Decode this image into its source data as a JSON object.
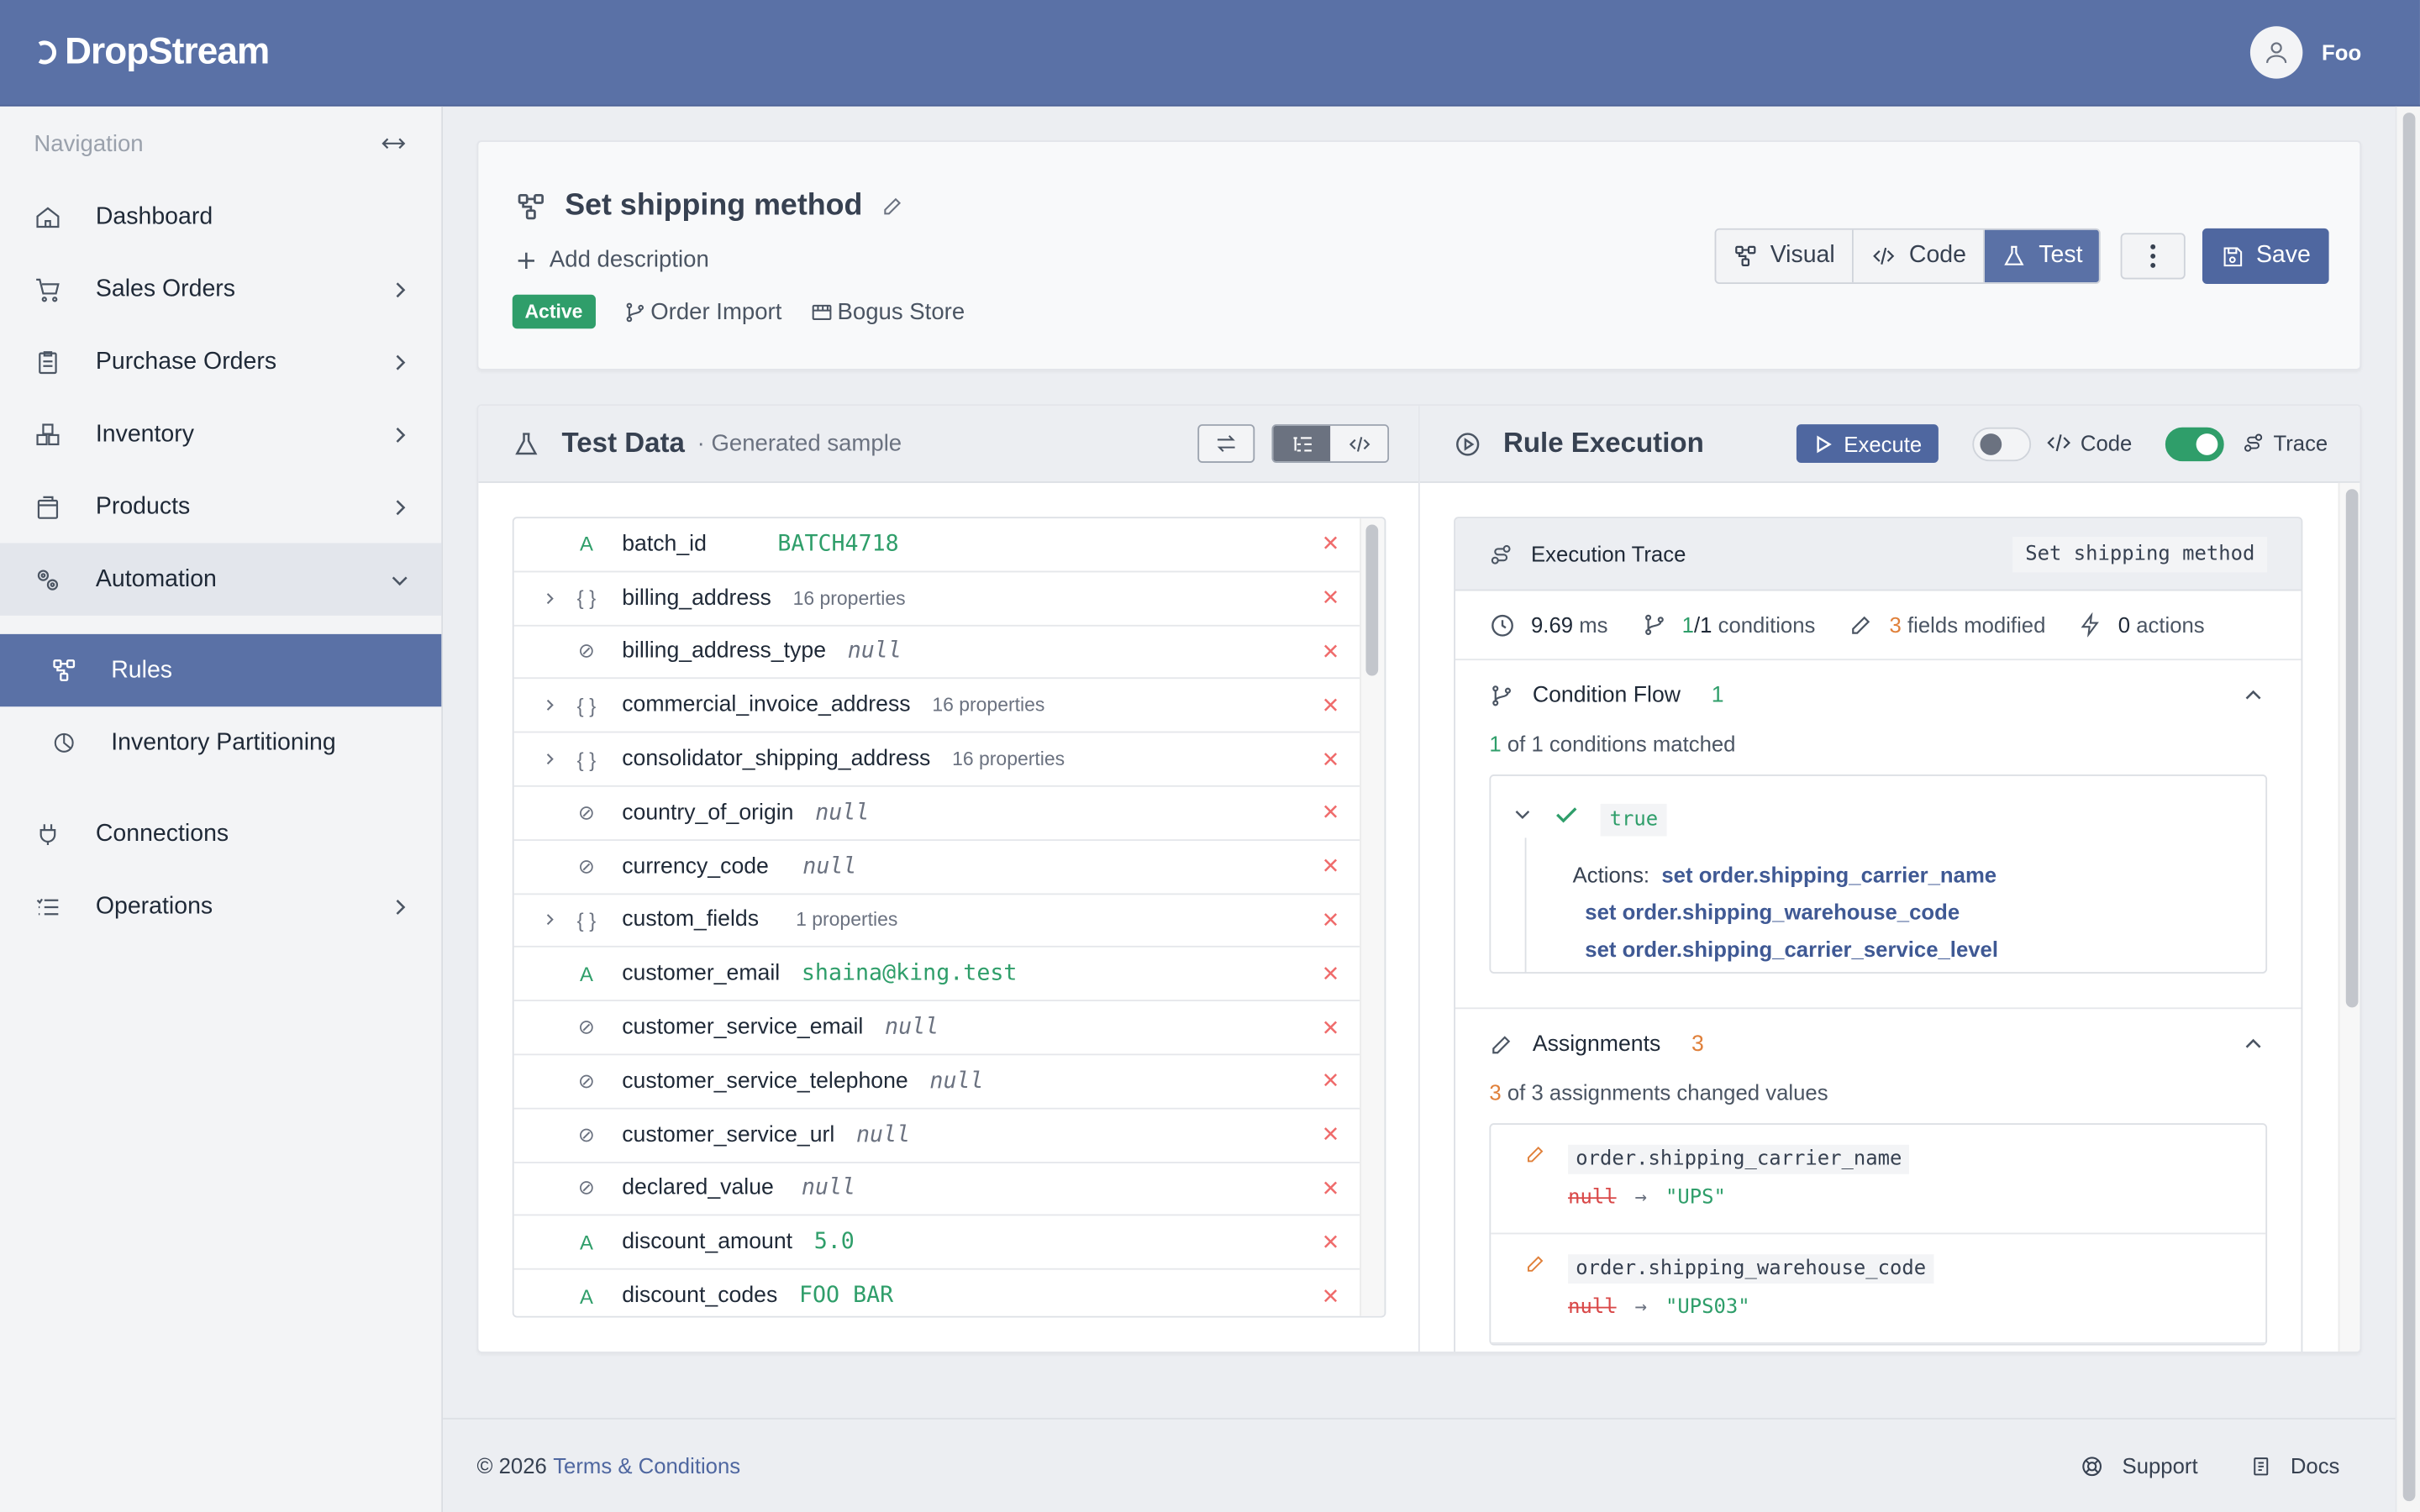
{
  "brand": {
    "name": "DropStream"
  },
  "user": {
    "name": "Foo"
  },
  "nav": {
    "title": "Navigation",
    "items": [
      {
        "label": "Dashboard",
        "icon": "home-icon"
      },
      {
        "label": "Sales Orders",
        "icon": "cart-icon"
      },
      {
        "label": "Purchase Orders",
        "icon": "clipboard-icon"
      },
      {
        "label": "Inventory",
        "icon": "boxes-icon"
      },
      {
        "label": "Products",
        "icon": "package-icon"
      },
      {
        "label": "Automation",
        "icon": "cogs-icon"
      },
      {
        "label": "Connections",
        "icon": "plug-icon"
      },
      {
        "label": "Operations",
        "icon": "list-icon"
      }
    ],
    "sub_items": [
      {
        "label": "Rules",
        "icon": "flow-icon",
        "active": true
      },
      {
        "label": "Inventory Partitioning",
        "icon": "pie-icon"
      }
    ]
  },
  "rule": {
    "title": "Set shipping method",
    "add_description": "Add description",
    "status": "Active",
    "trigger": "Order Import",
    "store": "Bogus Store"
  },
  "toolbar": {
    "visual": "Visual",
    "code": "Code",
    "test": "Test",
    "save": "Save"
  },
  "test_data": {
    "title": "Test Data",
    "subtitle": "· Generated sample",
    "fields": [
      {
        "key": "batch_id",
        "type": "string",
        "value": "BATCH4718"
      },
      {
        "key": "billing_address",
        "type": "object",
        "value": "16 properties"
      },
      {
        "key": "billing_address_type",
        "type": "null",
        "value": "null"
      },
      {
        "key": "commercial_invoice_address",
        "type": "object",
        "value": "16 properties"
      },
      {
        "key": "consolidator_shipping_address",
        "type": "object",
        "value": "16 properties"
      },
      {
        "key": "country_of_origin",
        "type": "null",
        "value": "null"
      },
      {
        "key": "currency_code",
        "type": "null",
        "value": "null"
      },
      {
        "key": "custom_fields",
        "type": "object",
        "value": "1 properties"
      },
      {
        "key": "customer_email",
        "type": "string",
        "value": "shaina@king.test"
      },
      {
        "key": "customer_service_email",
        "type": "null",
        "value": "null"
      },
      {
        "key": "customer_service_telephone",
        "type": "null",
        "value": "null"
      },
      {
        "key": "customer_service_url",
        "type": "null",
        "value": "null"
      },
      {
        "key": "declared_value",
        "type": "null",
        "value": "null"
      },
      {
        "key": "discount_amount",
        "type": "string",
        "value": "5.0"
      },
      {
        "key": "discount_codes",
        "type": "string",
        "value": "FOO BAR"
      }
    ]
  },
  "execution": {
    "title": "Rule Execution",
    "execute": "Execute",
    "code_label": "Code",
    "trace_label": "Trace",
    "trace_title": "Execution Trace",
    "rule_name": "Set shipping method",
    "stats": {
      "ms": "9.69",
      "ms_unit": "ms",
      "cond_matched": "1",
      "cond_total": "/1",
      "cond_label": "conditions",
      "fields": "3",
      "fields_label": "fields modified",
      "actions": "0",
      "actions_label": "actions"
    },
    "condition_flow": {
      "title": "Condition Flow",
      "count": "1",
      "summary_num": "1",
      "summary_text": "of 1 conditions matched",
      "result": "true",
      "actions_label": "Actions:",
      "actions": [
        "set order.shipping_carrier_name",
        "set order.shipping_warehouse_code",
        "set order.shipping_carrier_service_level"
      ]
    },
    "assignments": {
      "title": "Assignments",
      "count": "3",
      "summary_num": "3",
      "summary_text": "of 3 assignments changed values",
      "items": [
        {
          "path": "order.shipping_carrier_name",
          "old": "null",
          "arrow": "→",
          "new": "\"UPS\""
        },
        {
          "path": "order.shipping_warehouse_code",
          "old": "null",
          "arrow": "→",
          "new": "\"UPS03\""
        }
      ]
    }
  },
  "footer": {
    "copyright": "© 2026",
    "terms": "Terms & Conditions",
    "support": "Support",
    "docs": "Docs"
  },
  "colors": {
    "primary": "#5a71a6",
    "success": "#2f9e6a",
    "warning": "#e0803a",
    "danger": "#ef6b6b"
  }
}
